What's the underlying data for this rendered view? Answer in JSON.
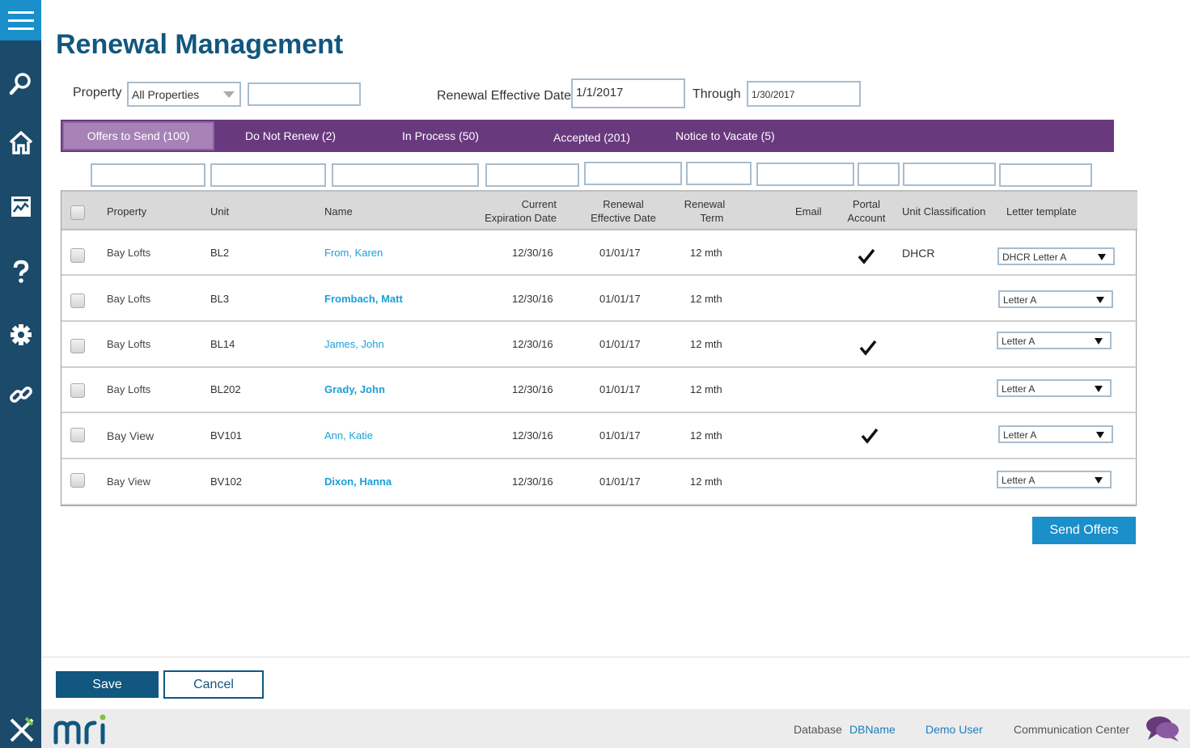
{
  "page_title": "Renewal Management",
  "filters": {
    "property_label": "Property",
    "property_value": "All Properties",
    "property_search_value": "",
    "renewal_effective_label": "Renewal Effective Date",
    "renewal_effective_value": "1/1/2017",
    "through_label": "Through",
    "through_value": "1/30/2017"
  },
  "tabs": [
    {
      "label": "Offers to Send (100)",
      "active": true
    },
    {
      "label": "Do Not Renew (2)",
      "active": false
    },
    {
      "label": "In Process (50)",
      "active": false
    },
    {
      "label": "Accepted (201)",
      "active": false
    },
    {
      "label": "Notice to Vacate (5)",
      "active": false
    }
  ],
  "table": {
    "columns": {
      "property": "Property",
      "unit": "Unit",
      "name": "Name",
      "current_exp_1": "Current",
      "current_exp_2": "Expiration Date",
      "renewal_eff_1": "Renewal",
      "renewal_eff_2": "Effective Date",
      "renewal_term_1": "Renewal",
      "renewal_term_2": "Term",
      "email": "Email",
      "portal_1": "Portal",
      "portal_2": "Account",
      "unit_class": "Unit Classification",
      "letter_template": "Letter template"
    },
    "rows": [
      {
        "property": "Bay Lofts",
        "unit": "BL2",
        "name": "From, Karen",
        "name_bold": false,
        "current_exp": "12/30/16",
        "renewal_eff": "01/01/17",
        "term": "12 mth",
        "portal": true,
        "unit_class": "DHCR",
        "letter": "DHCR Letter A"
      },
      {
        "property": "Bay Lofts",
        "unit": "BL3",
        "name": "Frombach, Matt",
        "name_bold": true,
        "current_exp": "12/30/16",
        "renewal_eff": "01/01/17",
        "term": "12 mth",
        "portal": false,
        "unit_class": "",
        "letter": "Letter A"
      },
      {
        "property": "Bay Lofts",
        "unit": "BL14",
        "name": "James, John",
        "name_bold": false,
        "current_exp": "12/30/16",
        "renewal_eff": "01/01/17",
        "term": "12 mth",
        "portal": true,
        "unit_class": "",
        "letter": "Letter A"
      },
      {
        "property": "Bay Lofts",
        "unit": "BL202",
        "name": "Grady, John",
        "name_bold": true,
        "current_exp": "12/30/16",
        "renewal_eff": "01/01/17",
        "term": "12 mth",
        "portal": false,
        "unit_class": "",
        "letter": "Letter A"
      },
      {
        "property": "Bay View",
        "unit": "BV101",
        "name": "Ann, Katie",
        "name_bold": false,
        "current_exp": "12/30/16",
        "renewal_eff": "01/01/17",
        "term": "12 mth",
        "portal": true,
        "unit_class": "",
        "letter": "Letter A"
      },
      {
        "property": "Bay View",
        "unit": "BV102",
        "name": "Dixon, Hanna",
        "name_bold": true,
        "current_exp": "12/30/16",
        "renewal_eff": "01/01/17",
        "term": "12 mth",
        "portal": false,
        "unit_class": "",
        "letter": "Letter A"
      }
    ]
  },
  "actions": {
    "send_offers": "Send Offers",
    "save": "Save",
    "cancel": "Cancel"
  },
  "footer": {
    "database_label": "Database",
    "database_name": "DBName",
    "user": "Demo User",
    "comm_center": "Communication Center"
  },
  "colors": {
    "sidebar": "#1b4a6b",
    "accent": "#1a8fc9",
    "tabbar": "#69397e",
    "title": "#11577f",
    "link": "#1aa0d8"
  },
  "icons": {
    "sidebar": [
      "menu-icon",
      "search-icon",
      "home-icon",
      "report-icon",
      "help-icon",
      "gear-icon",
      "link-icon"
    ]
  }
}
